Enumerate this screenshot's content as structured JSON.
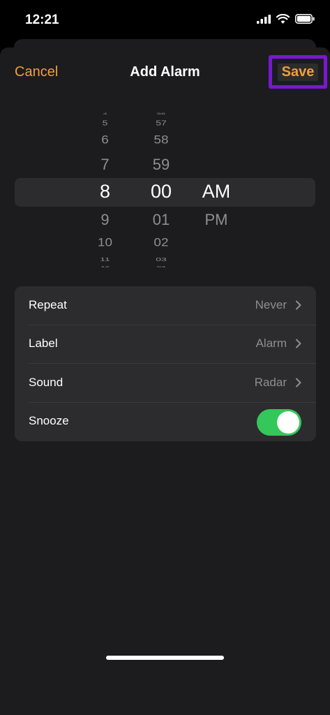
{
  "status_bar": {
    "time": "12:21",
    "icons": [
      "cellular-signal-icon",
      "wifi-icon",
      "battery-icon"
    ]
  },
  "nav": {
    "cancel_label": "Cancel",
    "title": "Add Alarm",
    "save_label": "Save",
    "accent_color": "#f0a03a"
  },
  "picker": {
    "hours": [
      "4",
      "5",
      "6",
      "7",
      "8",
      "9",
      "10",
      "11",
      "12"
    ],
    "minutes": [
      "56",
      "57",
      "58",
      "59",
      "00",
      "01",
      "02",
      "03",
      "04"
    ],
    "ampm": [
      "AM",
      "PM"
    ],
    "selected_hour": "8",
    "selected_minute": "00",
    "selected_period": "AM"
  },
  "settings": {
    "repeat": {
      "label": "Repeat",
      "value": "Never"
    },
    "alarm_label": {
      "label": "Label",
      "value": "Alarm"
    },
    "sound": {
      "label": "Sound",
      "value": "Radar"
    },
    "snooze": {
      "label": "Snooze",
      "enabled": true,
      "on_color": "#34c759"
    }
  }
}
